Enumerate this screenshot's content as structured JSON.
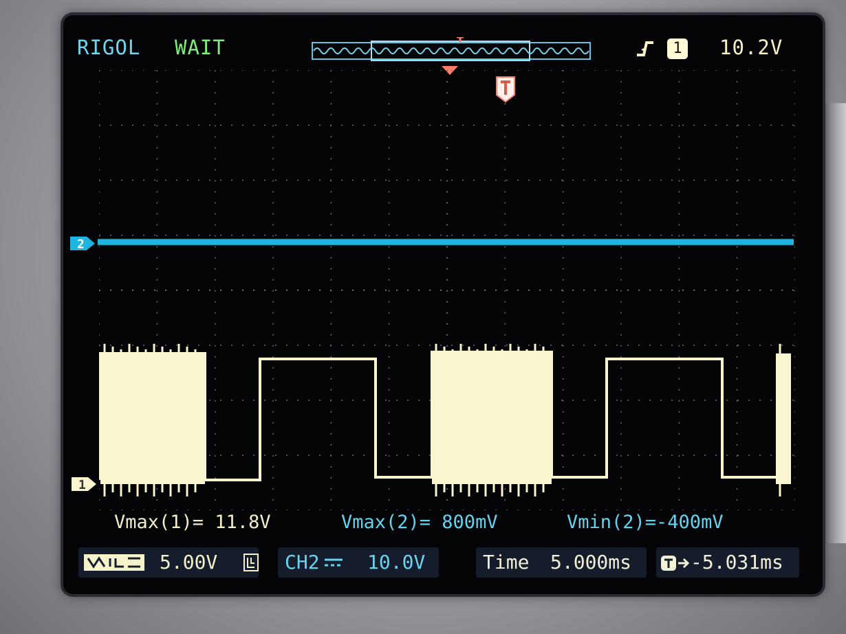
{
  "header": {
    "brand": "RIGOL",
    "status": "WAIT",
    "trigger_channel": "1",
    "trigger_level": "10.2V",
    "icons": [
      "rising-edge-trigger-icon",
      "memory-timebar-icon",
      "trigger-position-icon"
    ]
  },
  "channels": {
    "ch1": {
      "marker": "1",
      "color": "#f8f5cf"
    },
    "ch2": {
      "marker": "2",
      "color": "#1fb3e0"
    }
  },
  "measurements": [
    {
      "label": "Vmax(1)= 11.8V"
    },
    {
      "label": "Vmax(2)= 800mV"
    },
    {
      "label": "Vmin(2)=-400mV"
    }
  ],
  "status_bar": {
    "ch1_scale": "5.00V",
    "ch2_label": "CH2",
    "ch2_scale": "10.0V",
    "time_label": "Time",
    "time_scale": "5.000ms",
    "trigger_offset": "-5.031ms"
  },
  "colors": {
    "brand": "#6ed7ef",
    "status": "#7df079",
    "trigger": "#ff7b6a",
    "ch1": "#f8f5cf",
    "ch2": "#1fb3e0",
    "grid": "#5d6b7a"
  }
}
